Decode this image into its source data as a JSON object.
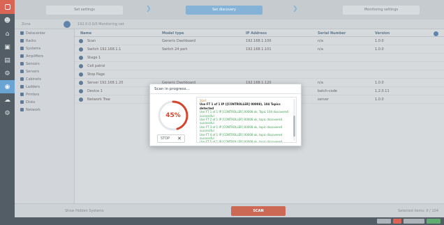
{
  "steps": [
    {
      "label": "Set settings",
      "active": false
    },
    {
      "label": "Set discovery",
      "active": true
    },
    {
      "label": "Monitoring settings",
      "active": false
    }
  ],
  "subheader": {
    "label": "Zone",
    "path": "192.0.0.0/0 Monitoring net"
  },
  "tree": {
    "items": [
      {
        "label": "Datacenter",
        "selected": false
      },
      {
        "label": "Racks",
        "selected": false
      },
      {
        "label": "Systems",
        "selected": false
      },
      {
        "label": "Amplifiers",
        "selected": false
      },
      {
        "label": "Sensors",
        "selected": false
      },
      {
        "label": "Servers",
        "selected": false
      },
      {
        "label": "Cabinets",
        "selected": false
      },
      {
        "label": "Ladders",
        "selected": false
      },
      {
        "label": "Printers",
        "selected": false
      },
      {
        "label": "Disks",
        "selected": false
      },
      {
        "label": "Network",
        "selected": false
      }
    ]
  },
  "table": {
    "headers": [
      "Name",
      "Model type",
      "IP Address",
      "Serial Number",
      "Version"
    ],
    "rows": [
      [
        "Scan",
        "Generic Dashboard",
        "192.168.1.100",
        "n/a",
        "1.0.0"
      ],
      [
        "Switch 192.168.1.1",
        "Switch 24 port",
        "192.168.1.101",
        "n/a",
        "1.0.0"
      ],
      [
        "Stage 1",
        "",
        "",
        "",
        ""
      ],
      [
        "Cell patrol",
        "",
        "",
        "",
        ""
      ],
      [
        "Stop Page",
        "",
        "",
        "",
        ""
      ],
      [
        "Server 192.168.1.20",
        "Generic Dashboard",
        "192.168.1.120",
        "n/a",
        "1.0.0"
      ],
      [
        "Device 1",
        "",
        "",
        "batch-code",
        "1.2.0.11"
      ],
      [
        "Network Tree",
        "",
        "",
        "server",
        "1.0.0"
      ]
    ]
  },
  "modal": {
    "title": "Scan in progress...",
    "progress_label": "45%",
    "progress_value": 45,
    "stop_label": "STOP",
    "log": [
      {
        "kind": "head",
        "text": "Start"
      },
      {
        "kind": "bold",
        "text": "Use FT 1 of 1 IP ([CONTROLLER] 00008), 104 Topics detected"
      },
      {
        "kind": "ok",
        "text": "Use FT 1 of 1 IP [CONTROLLER] 00008 ok, Topic 104 discovered successful"
      },
      {
        "kind": "ok",
        "text": "Use FT 2 of 1 IP [CONTROLLER] 00008 ok, topic discovered successful"
      },
      {
        "kind": "ok",
        "text": "Use FT 3 of 1 IP [CONTROLLER] 00008 ok, topic discovered successful"
      },
      {
        "kind": "ok",
        "text": "Use FT 4 of 1 IP [CONTROLLER] 00008 ok, topic discovered successful"
      },
      {
        "kind": "ok",
        "text": "Use FT 5 of 1 IP [CONTROLLER] 00008 ok, topic discovered successful"
      }
    ]
  },
  "bottombar": {
    "left_label": "Show Hidden Systems",
    "start_label": "SCAN",
    "right_label": "Selected items: 0 / 104"
  },
  "colors": {
    "accent": "#d1442f",
    "primary": "#4a90c8",
    "ok": "#3e9a52"
  }
}
